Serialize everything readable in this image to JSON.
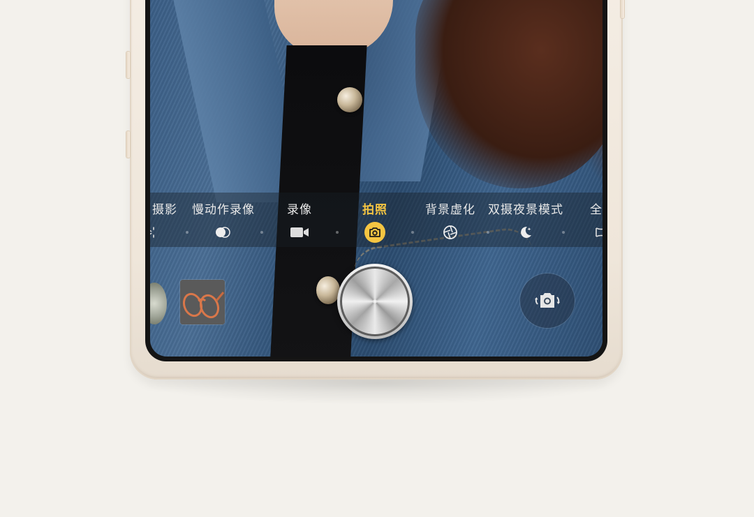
{
  "camera": {
    "modes": [
      {
        "label": "摄影",
        "icon": "aperture-partial-icon",
        "active": false
      },
      {
        "label": "慢动作录像",
        "icon": "slow-motion-icon",
        "active": false
      },
      {
        "label": "录像",
        "icon": "video-camera-icon",
        "active": false
      },
      {
        "label": "拍照",
        "icon": "camera-icon",
        "active": true
      },
      {
        "label": "背景虚化",
        "icon": "aperture-icon",
        "active": false
      },
      {
        "label": "双摄夜景模式",
        "icon": "moon-star-icon",
        "active": false
      },
      {
        "label": "全",
        "icon": "panorama-icon",
        "active": false
      }
    ],
    "accent_color": "#f5c542",
    "controls": {
      "gallery": "gallery-thumbnail",
      "shutter": "shutter-button",
      "switch": "switch-camera-icon"
    }
  }
}
